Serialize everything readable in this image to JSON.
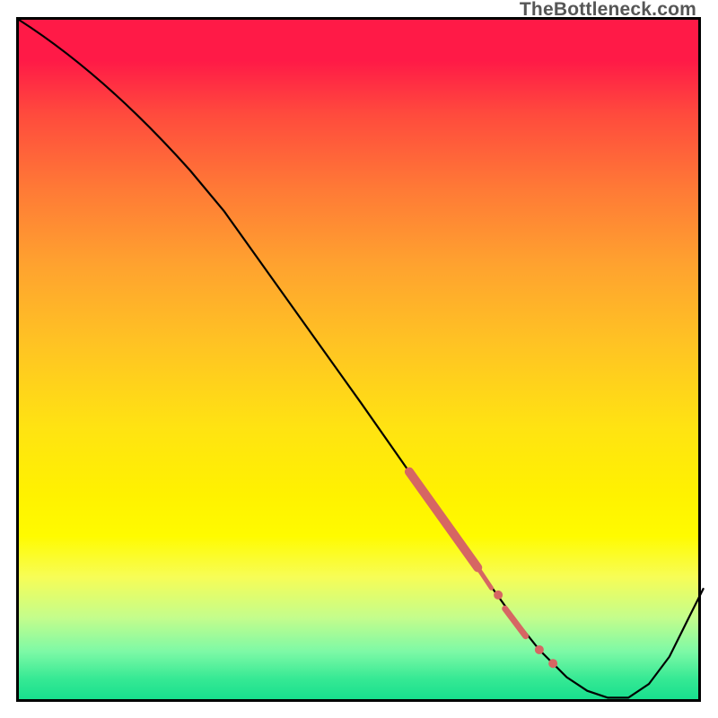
{
  "watermark": "TheBottleneck.com",
  "chart_data": {
    "type": "line",
    "title": "",
    "xlabel": "",
    "ylabel": "",
    "xlim": [
      0,
      100
    ],
    "ylim": [
      0,
      100
    ],
    "grid": false,
    "legend": false,
    "background": "heatmap-gradient-red-to-green",
    "curve_points": [
      {
        "x": 0,
        "y": 100
      },
      {
        "x": 25,
        "y": 78
      },
      {
        "x": 30,
        "y": 72
      },
      {
        "x": 40,
        "y": 58
      },
      {
        "x": 50,
        "y": 44
      },
      {
        "x": 57,
        "y": 34
      },
      {
        "x": 62,
        "y": 27
      },
      {
        "x": 67,
        "y": 20
      },
      {
        "x": 72,
        "y": 13
      },
      {
        "x": 76,
        "y": 8
      },
      {
        "x": 80,
        "y": 4
      },
      {
        "x": 83,
        "y": 2
      },
      {
        "x": 86,
        "y": 1
      },
      {
        "x": 89,
        "y": 1
      },
      {
        "x": 92,
        "y": 3
      },
      {
        "x": 95,
        "y": 7
      },
      {
        "x": 98,
        "y": 13
      },
      {
        "x": 100,
        "y": 17
      }
    ],
    "highlight_segments": [
      {
        "x1": 57,
        "y1": 34,
        "x2": 67,
        "y2": 20,
        "thickness": 10
      },
      {
        "x1": 67,
        "y1": 20,
        "x2": 69,
        "y2": 17,
        "thickness": 5
      },
      {
        "x1": 71,
        "y1": 14,
        "x2": 74,
        "y2": 10,
        "thickness": 7
      }
    ],
    "highlight_points": [
      {
        "x": 70,
        "y": 16
      },
      {
        "x": 76,
        "y": 8
      },
      {
        "x": 78,
        "y": 6
      }
    ]
  },
  "colors": {
    "curve": "#000000",
    "marker": "#d66663",
    "border": "#000000",
    "watermark": "#565656"
  }
}
